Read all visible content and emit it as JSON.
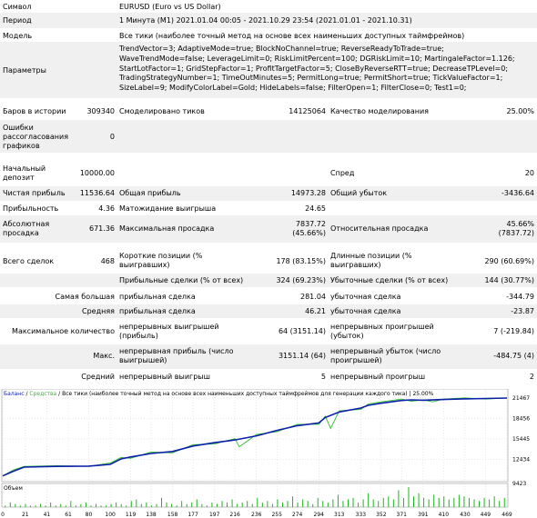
{
  "report": {
    "symbol_label": "Символ",
    "symbol_value": "EURUSD (Euro vs US Dollar)",
    "period_label": "Период",
    "period_value": "1 Минута (M1) 2021.01.04 00:05 - 2021.10.29 23:54 (2021.01.01 - 2021.10.31)",
    "model_label": "Модель",
    "model_value": "Все тики (наиболее точный метод на основе всех наименьших доступных таймфреймов)",
    "params_label": "Параметры",
    "params_lines": [
      "TrendVector=3; AdaptiveMode=true; BlockNoChannel=true; ReverseReadyToTrade=true;",
      "WaveTrendMode=false; LeverageLimit=0; RiskLimitPercent=100; DGRiskLimit=10; MartingaleFactor=1.126;",
      "StartLotFactor=1; GridStepFactor=1; ProfitTargetFactor=5; CloseByReverseRTT=true; DecreaseTPLevel=0;",
      "TradingStrategyNumber=1; TimeOutMinutes=5; PermitLong=true; PermitShort=true; TickValueFactor=1;",
      "SizeLabel=9; ModifyColorLabel=Gold; HideLabels=false; FilterOpen=1; FilterClose=0; Test1=0;"
    ],
    "bars_label": "Баров в истории",
    "bars_value": "309340",
    "ticks_label": "Смоделировано тиков",
    "ticks_value": "14125064",
    "quality_label": "Качество моделирования",
    "quality_value": "25.00%",
    "errors_label_1": "Ошибки",
    "errors_label_2": "рассогласования",
    "errors_label_3": "графиков",
    "errors_value": "0",
    "deposit_label_1": "Начальный",
    "deposit_label_2": "депозит",
    "deposit_value": "10000.00",
    "spread_label": "Спред",
    "spread_value": "20",
    "net_profit_label": "Чистая прибыль",
    "net_profit_value": "11536.64",
    "gross_profit_label": "Общая прибыль",
    "gross_profit_value": "14973.28",
    "gross_loss_label": "Общий убыток",
    "gross_loss_value": "-3436.64",
    "profit_factor_label": "Прибыльность",
    "profit_factor_value": "4.36",
    "expected_payoff_label": "Матожидание выигрыша",
    "expected_payoff_value": "24.65",
    "abs_dd_label_1": "Абсолютная",
    "abs_dd_label_2": "просадка",
    "abs_dd_value": "671.36",
    "max_dd_label": "Максимальная просадка",
    "max_dd_value_1": "7837.72",
    "max_dd_value_2": "(45.66%)",
    "rel_dd_label": "Относительная просадка",
    "rel_dd_value_1": "45.66%",
    "rel_dd_value_2": "(7837.72)",
    "total_trades_label": "Всего сделок",
    "total_trades_value": "468",
    "short_label_1": "Короткие позиции (%",
    "short_label_2": "выигравших)",
    "short_value": "178 (83.15%)",
    "long_label_1": "Длинные позиции (%",
    "long_label_2": "выигравших)",
    "long_value": "290 (60.69%)",
    "profit_trades_label": "Прибыльные сделки (% от всех)",
    "profit_trades_value": "324 (69.23%)",
    "loss_trades_label": "Убыточные сделки (% от всех)",
    "loss_trades_value": "144 (30.77%)",
    "largest_label": "Самая большая",
    "largest_profit_label": "прибыльная сделка",
    "largest_profit_value": "281.04",
    "largest_loss_label": "убыточная сделка",
    "largest_loss_value": "-344.79",
    "average_label": "Средняя",
    "average_profit_label": "прибыльная сделка",
    "average_profit_value": "46.21",
    "average_loss_label": "убыточная сделка",
    "average_loss_value": "-23.87",
    "max_count_label": "Максимальное количество",
    "cons_wins_label_1": "непрерывных выигрышей",
    "cons_wins_label_2": "(прибыль)",
    "cons_wins_value": "64 (3151.14)",
    "cons_losses_label_1": "непрерывных проигрышей",
    "cons_losses_label_2": "(убыток)",
    "cons_losses_value": "7 (-219.84)",
    "max_label": "Макс.",
    "max_cons_profit_label_1": "непрерывная прибыль (число",
    "max_cons_profit_label_2": "выигрышей)",
    "max_cons_profit_value": "3151.14 (64)",
    "max_cons_loss_label_1": "непрерывный убыток (число",
    "max_cons_loss_label_2": "проигрышей)",
    "max_cons_loss_value": "-484.75 (4)",
    "avg_label": "Средний",
    "avg_cons_wins_label": "непрерывный выигрыш",
    "avg_cons_wins_value": "5",
    "avg_cons_losses_label": "непрерывный проигрыш",
    "avg_cons_losses_value": "2"
  },
  "chart_data": {
    "type": "line",
    "legend": [
      "Баланс",
      "Средства"
    ],
    "subtitle": "Все тики (наиболее точный метод на основе всех наименьших доступных таймфреймов для генерации каждого тика) | 25.00%",
    "colors": {
      "balance": "#0b1fa8",
      "equity": "#2fbf2f",
      "volume": "#22b322",
      "grid": "#c8c8c8"
    },
    "y_ticks": [
      "21467",
      "18456",
      "15445",
      "12434",
      "9423"
    ],
    "ylim": [
      9423,
      21467
    ],
    "volume_label": "Объем",
    "x_ticks": [
      "0",
      "21",
      "41",
      "61",
      "80",
      "100",
      "119",
      "138",
      "158",
      "177",
      "197",
      "216",
      "236",
      "255",
      "274",
      "294",
      "313",
      "333",
      "352",
      "371",
      "391",
      "410",
      "430",
      "449",
      "469"
    ],
    "xlim": [
      0,
      469
    ],
    "series": [
      {
        "name": "Баланс",
        "x": [
          0,
          10,
          20,
          50,
          80,
          100,
          110,
          119,
          138,
          158,
          177,
          197,
          216,
          236,
          255,
          274,
          294,
          300,
          313,
          333,
          340,
          352,
          371,
          380,
          391,
          410,
          430,
          449,
          469
        ],
        "values": [
          10000,
          10700,
          11300,
          11400,
          11450,
          11700,
          12500,
          12800,
          13300,
          13600,
          14400,
          14900,
          15300,
          15900,
          16700,
          17400,
          17800,
          18600,
          19400,
          20000,
          20400,
          20700,
          21100,
          21200,
          21150,
          21250,
          21350,
          21400,
          21467
        ]
      },
      {
        "name": "Средства",
        "x": [
          0,
          10,
          20,
          50,
          80,
          100,
          110,
          119,
          138,
          158,
          177,
          197,
          216,
          220,
          236,
          255,
          274,
          294,
          300,
          305,
          313,
          333,
          340,
          352,
          371,
          380,
          391,
          400,
          410,
          430,
          449,
          469
        ],
        "values": [
          10000,
          10900,
          11400,
          11500,
          11400,
          11900,
          12700,
          12600,
          13500,
          13400,
          14600,
          14700,
          15500,
          14300,
          16100,
          16500,
          17600,
          17600,
          18800,
          17000,
          19600,
          19800,
          20600,
          20900,
          21300,
          21000,
          21200,
          20900,
          21300,
          21500,
          21300,
          21500
        ]
      }
    ],
    "volume": [
      1,
      3,
      2,
      1,
      2,
      1,
      1,
      2,
      1,
      3,
      1,
      2,
      1,
      4,
      1,
      2,
      3,
      1,
      2,
      1,
      1,
      2,
      3,
      2,
      1,
      4,
      5,
      2,
      3,
      1,
      2,
      6,
      3,
      2,
      1,
      4,
      2,
      3,
      5,
      2,
      1,
      3,
      2,
      4,
      3,
      5,
      2,
      3,
      4,
      2,
      6,
      3,
      4,
      2,
      5,
      3,
      4,
      7,
      3,
      5,
      4,
      2,
      6,
      4,
      3,
      5,
      8,
      4,
      5,
      6,
      3,
      5,
      9,
      5,
      4,
      6,
      7,
      5,
      11,
      6,
      13,
      7,
      9,
      6,
      5,
      8,
      6,
      7,
      5,
      6,
      8,
      7,
      6,
      5,
      4,
      6,
      5,
      7,
      4,
      6
    ]
  }
}
